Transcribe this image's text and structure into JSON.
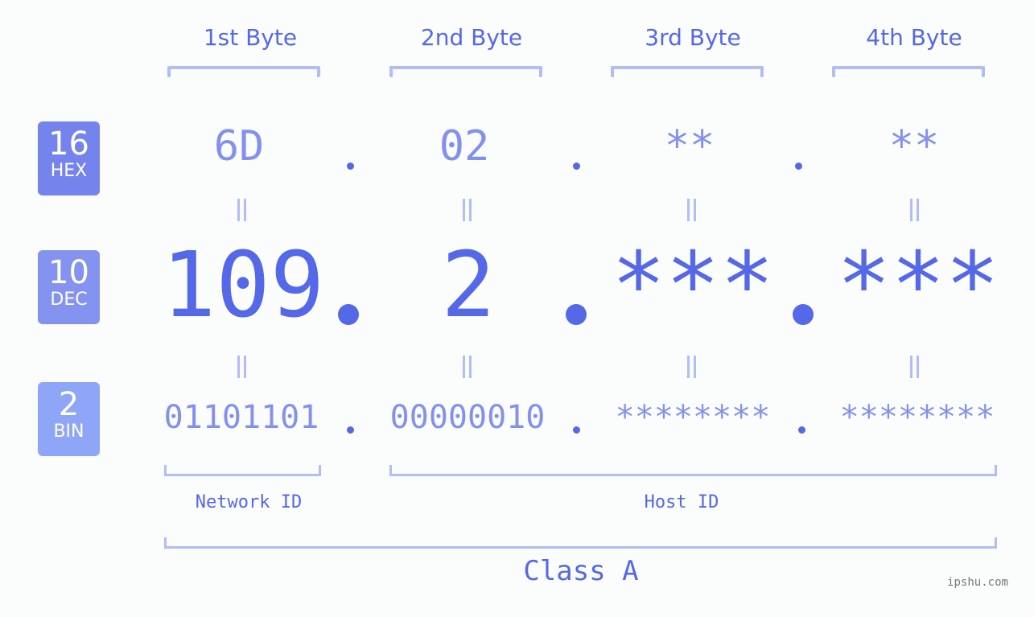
{
  "byte_headers": [
    "1st Byte",
    "2nd Byte",
    "3rd Byte",
    "4th Byte"
  ],
  "badges": {
    "hex": {
      "number": "16",
      "label": "HEX",
      "color": "#7584ec"
    },
    "dec": {
      "number": "10",
      "label": "DEC",
      "color": "#8593f0"
    },
    "bin": {
      "number": "2",
      "label": "BIN",
      "color": "#8fa6f8"
    }
  },
  "hex_values": [
    "6D",
    "02",
    "**",
    "**"
  ],
  "dec_values": [
    "109",
    "2",
    "***",
    "***"
  ],
  "bin_values": [
    "01101101",
    "00000010",
    "********",
    "********"
  ],
  "labels": {
    "network_id": "Network ID",
    "host_id": "Host ID",
    "ip_class": "Class A"
  },
  "watermark": "ipshu.com",
  "colors": {
    "primary": "#5468e8",
    "secondary": "#8291ee",
    "bracket": "#b2bcf6"
  }
}
